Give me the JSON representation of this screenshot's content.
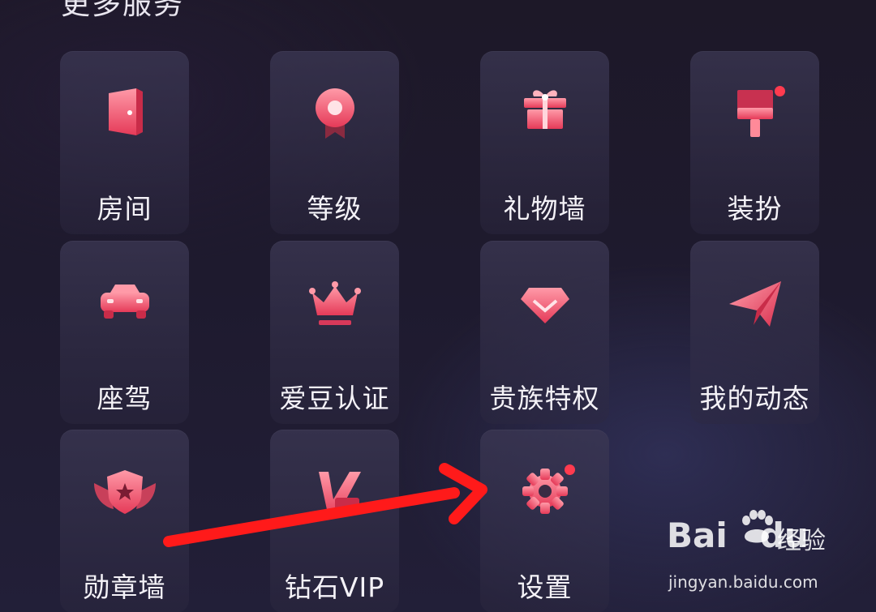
{
  "section": {
    "title": "更多服务"
  },
  "services": [
    {
      "label": "房间",
      "icon": "door-icon",
      "badge": false
    },
    {
      "label": "等级",
      "icon": "level-medal-icon",
      "badge": false
    },
    {
      "label": "礼物墙",
      "icon": "gift-icon",
      "badge": false
    },
    {
      "label": "装扮",
      "icon": "paint-brush-icon",
      "badge": true
    },
    {
      "label": "座驾",
      "icon": "car-icon",
      "badge": false
    },
    {
      "label": "爱豆认证",
      "icon": "crown-icon",
      "badge": false
    },
    {
      "label": "贵族特权",
      "icon": "diamond-icon",
      "badge": false
    },
    {
      "label": "我的动态",
      "icon": "paper-plane-icon",
      "badge": false
    },
    {
      "label": "勋章墙",
      "icon": "shield-badge-icon",
      "badge": false
    },
    {
      "label": "钻石VIP",
      "icon": "vip-icon",
      "badge": false
    },
    {
      "label": "设置",
      "icon": "gear-icon",
      "badge": true
    }
  ],
  "watermark": {
    "brand_latin_1": "Bai",
    "brand_latin_2": "du",
    "brand_cn": "经验",
    "url": "jingyan.baidu.com"
  },
  "colors": {
    "icon_light": "#ff8a99",
    "icon_dark": "#e8405c",
    "badge": "#ff3b4f",
    "arrow": "#ff1a1a"
  }
}
